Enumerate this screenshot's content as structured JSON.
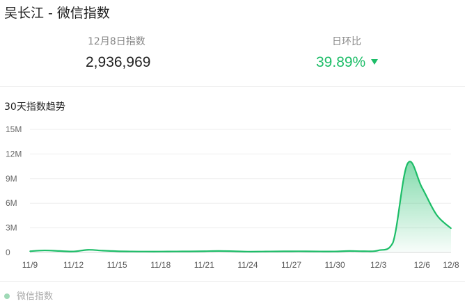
{
  "header": {
    "title": "吴长江 - 微信指数"
  },
  "stats": {
    "index_label": "12月8日指数",
    "index_value": "2,936,969",
    "ratio_label": "日环比",
    "ratio_value": "39.89%",
    "ratio_direction": "down"
  },
  "section_title": "30天指数趋势",
  "footer": {
    "label": "微信指数"
  },
  "colors": {
    "line": "#1dbd68",
    "fill": "#1dbd68",
    "ratio": "#1dbd68"
  },
  "chart_data": {
    "type": "area",
    "title": "",
    "xlabel": "",
    "ylabel": "",
    "ylim": [
      0,
      15000000
    ],
    "y_ticks": [
      0,
      3000000,
      6000000,
      9000000,
      12000000,
      15000000
    ],
    "y_tick_labels": [
      "0",
      "3M",
      "6M",
      "9M",
      "12M",
      "15M"
    ],
    "x_tick_labels": [
      "11/9",
      "11/12",
      "11/15",
      "11/18",
      "11/21",
      "11/24",
      "11/27",
      "11/30",
      "12/3",
      "12/6",
      "12/8"
    ],
    "grid": true,
    "x": [
      "11/9",
      "11/10",
      "11/11",
      "11/12",
      "11/13",
      "11/14",
      "11/15",
      "11/16",
      "11/17",
      "11/18",
      "11/19",
      "11/20",
      "11/21",
      "11/22",
      "11/23",
      "11/24",
      "11/25",
      "11/26",
      "11/27",
      "11/28",
      "11/29",
      "11/30",
      "12/1",
      "12/2",
      "12/3",
      "12/4",
      "12/5",
      "12/6",
      "12/7",
      "12/8"
    ],
    "series": [
      {
        "values": [
          150000,
          250000,
          180000,
          120000,
          320000,
          220000,
          150000,
          120000,
          110000,
          110000,
          120000,
          130000,
          150000,
          180000,
          150000,
          100000,
          110000,
          130000,
          140000,
          140000,
          120000,
          120000,
          180000,
          150000,
          250000,
          1200000,
          10800000,
          7900000,
          4600000,
          2936969
        ]
      }
    ]
  }
}
